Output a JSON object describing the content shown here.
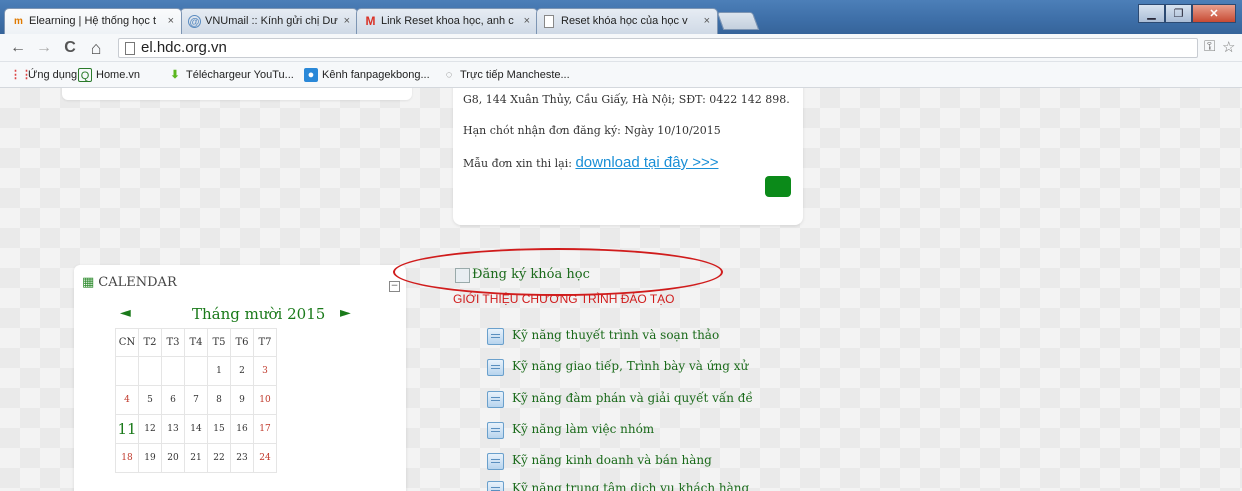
{
  "browser": {
    "tabs": [
      {
        "label": "Elearning | Hệ thống học t",
        "icon": "elearning-favicon",
        "active": true
      },
      {
        "label": "VNUmail :: Kính gửi chị Dư",
        "icon": "vnumail-favicon",
        "active": false
      },
      {
        "label": "Link Reset khoa học, anh c",
        "icon": "gmail-icon",
        "active": false
      },
      {
        "label": "Reset khóa học của học v",
        "icon": "page-icon",
        "active": false
      }
    ],
    "tab_close": "×",
    "window_buttons": {
      "minimize": "▁",
      "maximize": "❐",
      "close": "✕"
    },
    "nav": {
      "back": "←",
      "forward": "→",
      "reload": "C",
      "home": "⌂"
    },
    "url": "el.hdc.org.vn",
    "toolbar_right": {
      "key": "⚿",
      "star": "☆"
    },
    "bookmarks": [
      {
        "label": "Ứng dụng",
        "icon": "apps-icon"
      },
      {
        "label": "Home.vn",
        "icon": "home-vn-icon"
      },
      {
        "label": "Téléchargeur YouTu...",
        "icon": "download-icon"
      },
      {
        "label": "Kênh fanpagekbong...",
        "icon": "facebook-icon"
      },
      {
        "label": "Trực tiếp Mancheste...",
        "icon": "globe-icon"
      }
    ]
  },
  "notice": {
    "address": "G8, 144 Xuân Thủy, Cầu Giấy, Hà Nội; SĐT: 0422 142 898.",
    "deadline": "Hạn chót nhận đơn đăng ký: Ngày 10/10/2015",
    "form_prefix": "Mẫu đơn xin thi lại:",
    "form_link": "download tại đây >>>"
  },
  "calendar": {
    "title": "CALENDAR",
    "collapse": "−",
    "prev": "◄",
    "next": "►",
    "month": "Tháng mười 2015",
    "headers": [
      "CN",
      "T2",
      "T3",
      "T4",
      "T5",
      "T6",
      "T7"
    ],
    "weeks": [
      [
        "",
        "",
        "",
        "",
        "1",
        "2",
        "3"
      ],
      [
        "4",
        "5",
        "6",
        "7",
        "8",
        "9",
        "10"
      ],
      [
        "11",
        "12",
        "13",
        "14",
        "15",
        "16",
        "17"
      ],
      [
        "18",
        "19",
        "20",
        "21",
        "22",
        "23",
        "24"
      ]
    ],
    "today": "11"
  },
  "main": {
    "register_link": "Đăng ký khóa học",
    "section_title": "GIỚI THIỆU CHƯƠNG TRÌNH ĐÀO TẠO",
    "courses": [
      "Kỹ năng thuyết trình và soạn thảo",
      "Kỹ năng giao tiếp, Trình bày và ứng xử",
      "Kỹ năng đàm phán và giải quyết vấn đề",
      "Kỹ năng làm việc nhóm",
      "Kỹ năng kinh doanh và bán hàng",
      "Kỹ năng trung tâm dịch vụ khách hàng"
    ]
  }
}
